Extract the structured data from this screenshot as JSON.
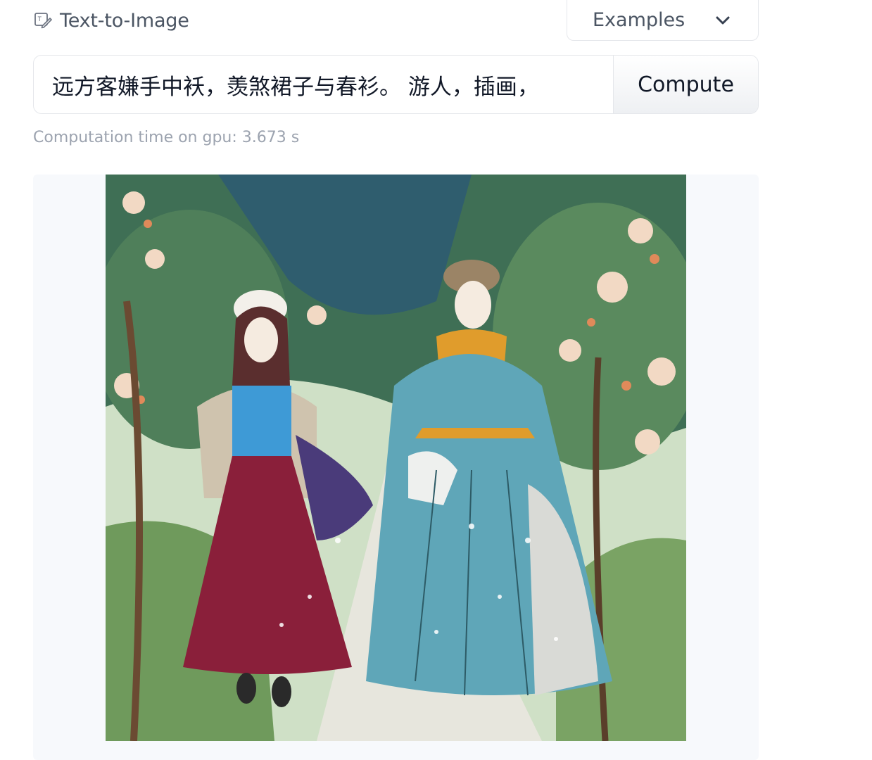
{
  "header": {
    "task_icon": "text-to-image-icon",
    "task_label": "Text-to-Image",
    "examples_label": "Examples",
    "examples_icon": "chevron-down-icon"
  },
  "input": {
    "prompt_value": "远方客嫌手中袄，羡煞裙子与春衫。 游人，插画，",
    "compute_label": "Compute"
  },
  "status": {
    "computation_time": "Computation time on gpu: 3.673 s"
  },
  "output": {
    "image_icon": "generated-painting-image"
  },
  "colors": {
    "text_primary": "#111827",
    "text_secondary": "#4b5563",
    "text_muted": "#9ca3af",
    "border": "#e5e7eb",
    "card_bg": "#f7f9fc"
  }
}
